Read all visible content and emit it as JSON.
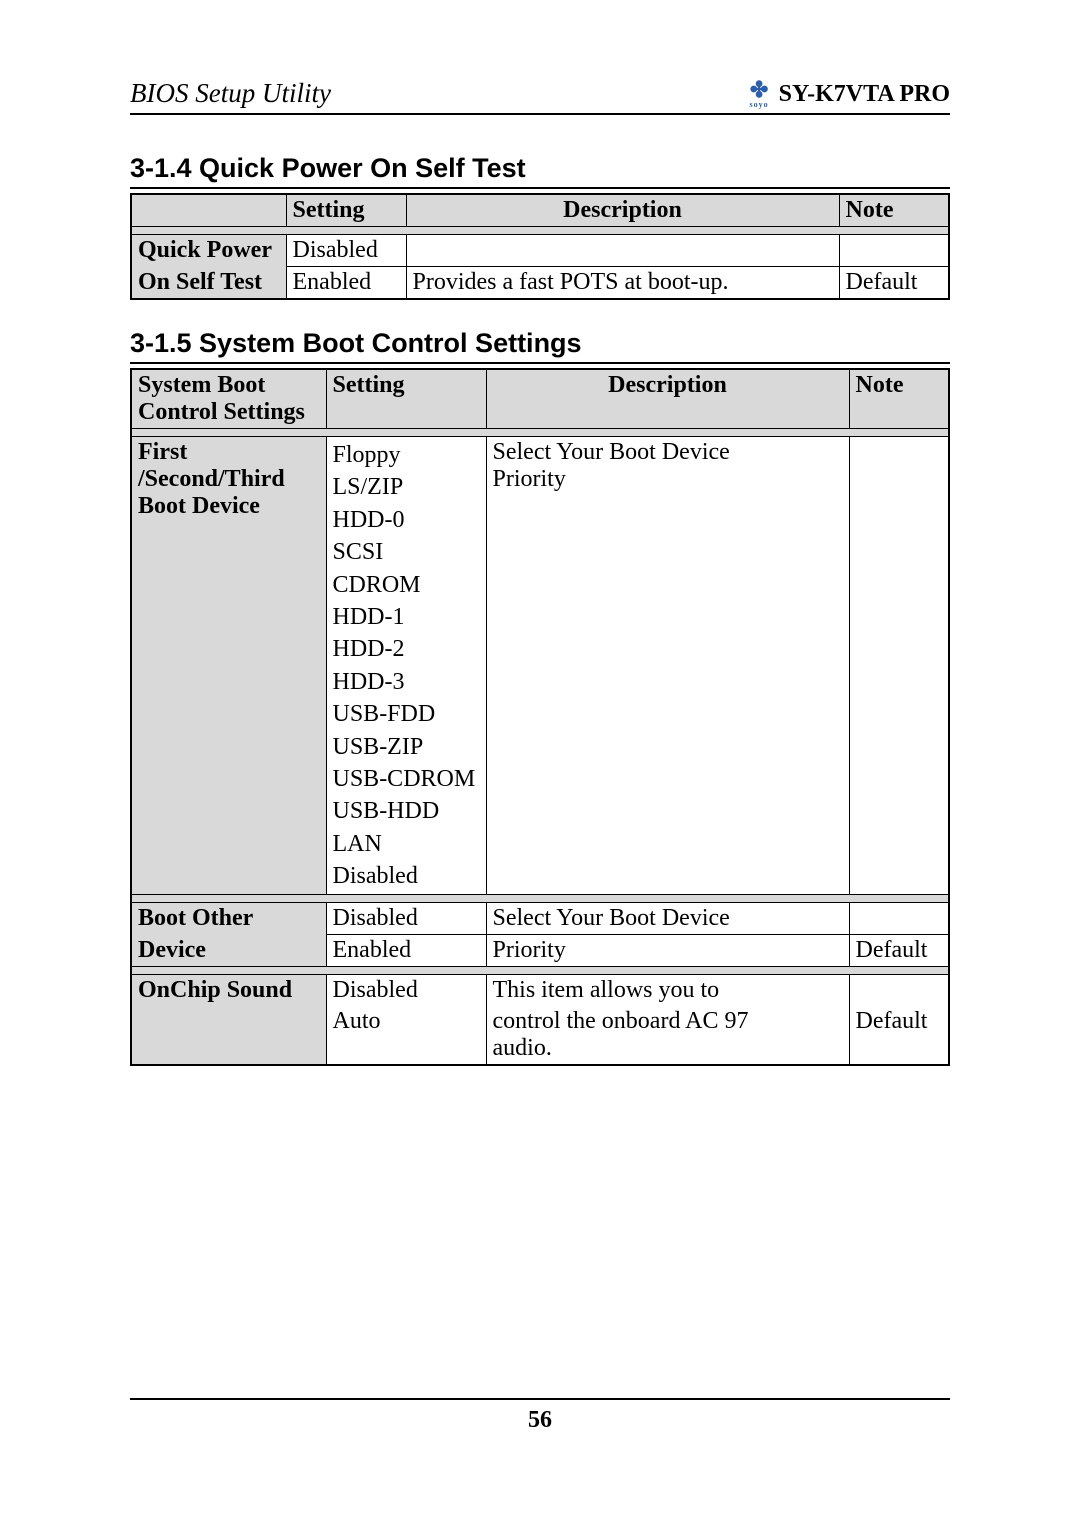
{
  "header": {
    "left": "BIOS Setup Utility",
    "right": "SY-K7VTA PRO"
  },
  "section1": {
    "title": "3-1.4  Quick Power On Self Test",
    "cols": {
      "c2": "Setting",
      "c3": "Description",
      "c4": "Note"
    },
    "row_label_1": "Quick Power",
    "row_label_2": "On Self Test",
    "r1": {
      "setting": "Disabled",
      "desc": "",
      "note": ""
    },
    "r2": {
      "setting": "Enabled",
      "desc": "Provides a fast POTS at boot-up.",
      "note": "Default"
    }
  },
  "section2": {
    "title": "3-1.5 System Boot Control Settings",
    "cols": {
      "c1a": "System Boot",
      "c1b": "Control Settings",
      "c2": "Setting",
      "c3": "Description",
      "c4": "Note"
    },
    "row1": {
      "label_a": "First",
      "label_b": "/Second/Third",
      "label_c": "Boot Device",
      "options": [
        "Floppy",
        "LS/ZIP",
        "HDD-0",
        "SCSI",
        "CDROM",
        "HDD-1",
        "HDD-2",
        "HDD-3",
        "USB-FDD",
        "USB-ZIP",
        "USB-CDROM",
        "USB-HDD",
        "LAN",
        "Disabled"
      ],
      "desc_a": "Select Your Boot Device",
      "desc_b": "Priority",
      "note": ""
    },
    "row2": {
      "label_a": "Boot Other",
      "label_b": "Device",
      "r1": {
        "setting": "Disabled",
        "desc": "Select Your Boot Device",
        "note": ""
      },
      "r2": {
        "setting": "Enabled",
        "desc": "Priority",
        "note": "Default"
      }
    },
    "row3": {
      "label": "OnChip Sound",
      "r1": {
        "setting": "Disabled",
        "desc": "This item allows you to",
        "note": ""
      },
      "r2": {
        "setting": "Auto",
        "desc_a": "control the onboard AC 97",
        "desc_b": "audio.",
        "note": "Default"
      }
    }
  },
  "page_number": "56"
}
